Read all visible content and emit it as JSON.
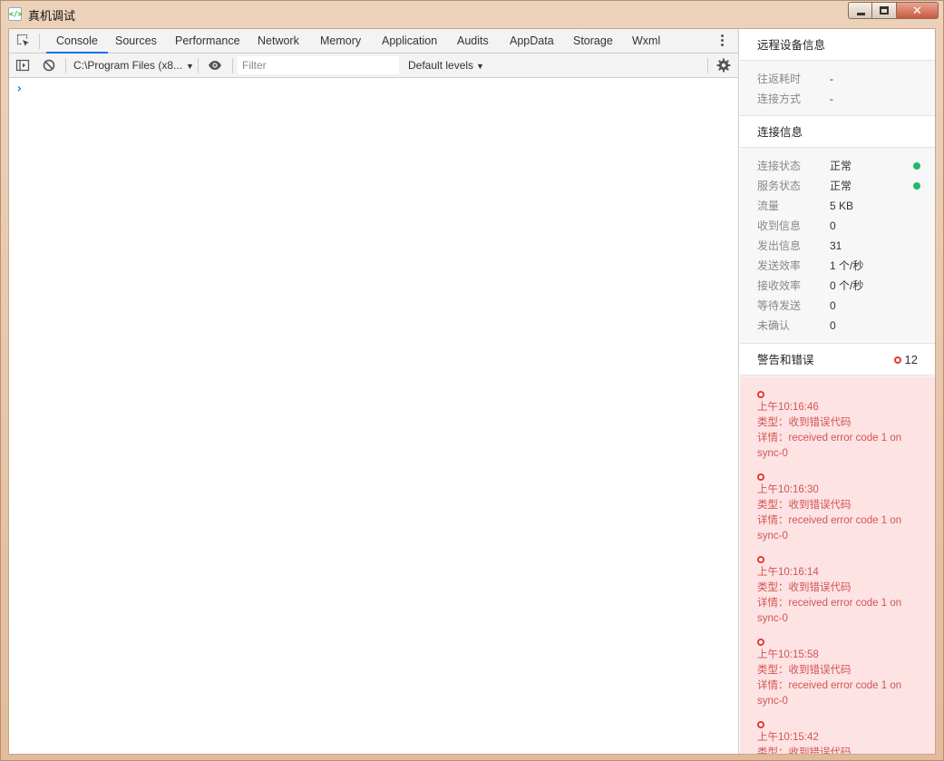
{
  "window": {
    "title": "真机调试",
    "app_icon_glyph": "</>",
    "close_glyph": "✕"
  },
  "devtools": {
    "tabs": [
      {
        "label": "Console",
        "active": true
      },
      {
        "label": "Sources"
      },
      {
        "label": "Performance"
      },
      {
        "label": "Network"
      },
      {
        "label": "Memory"
      },
      {
        "label": "Application"
      },
      {
        "label": "Audits"
      },
      {
        "label": "AppData"
      },
      {
        "label": "Storage"
      },
      {
        "label": "Wxml"
      }
    ],
    "toolbar": {
      "context": "C:\\Program Files (x8...",
      "filter_placeholder": "Filter",
      "filter_value": "",
      "levels": "Default levels",
      "arrow": "▼"
    },
    "console": {
      "prompt": "›"
    }
  },
  "sidepanel": {
    "remote": {
      "title": "远程设备信息",
      "items": [
        {
          "key": "往返耗时",
          "value": "-"
        },
        {
          "key": "连接方式",
          "value": "-"
        }
      ]
    },
    "connection": {
      "title": "连接信息",
      "items": [
        {
          "key": "连接状态",
          "value": "正常",
          "status": "ok"
        },
        {
          "key": "服务状态",
          "value": "正常",
          "status": "ok"
        },
        {
          "key": "流量",
          "value": "5 KB"
        },
        {
          "key": "收到信息",
          "value": "0"
        },
        {
          "key": "发出信息",
          "value": "31"
        },
        {
          "key": "发送效率",
          "value": "1 个/秒"
        },
        {
          "key": "接收效率",
          "value": "0 个/秒"
        },
        {
          "key": "等待发送",
          "value": "0"
        },
        {
          "key": "未确认",
          "value": "0"
        }
      ]
    },
    "warnings": {
      "title": "警告和错误",
      "count": "12",
      "items": [
        {
          "time": "上午10:16:46",
          "type": "类型：收到错误代码",
          "detail": "详情：received error code 1 on sync-0"
        },
        {
          "time": "上午10:16:30",
          "type": "类型：收到错误代码",
          "detail": "详情：received error code 1 on sync-0"
        },
        {
          "time": "上午10:16:14",
          "type": "类型：收到错误代码",
          "detail": "详情：received error code 1 on sync-0"
        },
        {
          "time": "上午10:15:58",
          "type": "类型：收到错误代码",
          "detail": "详情：received error code 1 on sync-0"
        },
        {
          "time": "上午10:15:42",
          "type": "类型：收到错误代码",
          "detail": ""
        }
      ]
    }
  },
  "colors": {
    "accent": "#1a73e8",
    "ok": "#1fba6a",
    "error": "#e53935",
    "error_text": "#d35454",
    "error_bg": "#fde3e3"
  },
  "icons": {
    "inspect": "inspect-element-icon",
    "sidebar": "show-sidebar-icon",
    "clear": "clear-console-icon",
    "eye": "live-expression-icon",
    "settings": "settings-gear-icon",
    "more": "more-vertical-icon"
  }
}
